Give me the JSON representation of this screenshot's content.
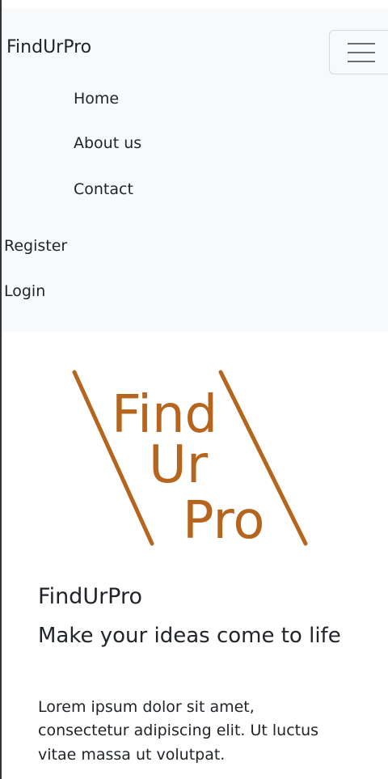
{
  "navbar": {
    "brand": "FindUrPro",
    "toggler_icon": "hamburger-menu-icon",
    "links": {
      "home": "Home",
      "about": "About us",
      "contact": "Contact",
      "register": "Register",
      "login": "Login"
    }
  },
  "logo": {
    "line1": "Find",
    "line2": "Ur",
    "line3": "Pro",
    "color": "#b5651d"
  },
  "hero": {
    "title": "FindUrPro",
    "subtitle": "Make your ideas come to life",
    "body": "Lorem ipsum dolor sit amet, consectetur adipiscing elit. Ut luctus vitae massa ut volutpat."
  },
  "colors": {
    "navbar_bg": "#f8f9fa",
    "text": "#212529",
    "logo_accent": "#b5651d"
  }
}
